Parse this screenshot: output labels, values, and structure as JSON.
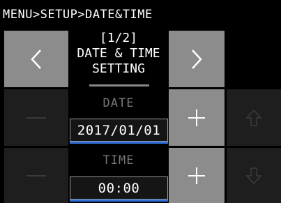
{
  "breadcrumb": "MENU>SETUP>DATE&TIME",
  "header": {
    "page_indicator": "[1/2]",
    "title_line1": "DATE & TIME",
    "title_line2": "SETTING"
  },
  "date": {
    "label": "DATE",
    "value": "2017/01/01"
  },
  "time": {
    "label": "TIME",
    "value": "00:00"
  },
  "icons": {
    "prev": "chevron-left-icon",
    "next": "chevron-right-icon",
    "decrement": "minus-icon",
    "increment": "plus-icon",
    "up": "arrow-up-icon",
    "down": "arrow-down-icon"
  },
  "colors": {
    "background": "#000000",
    "button": "#8c8c8c",
    "button_disabled": "#1e1e1e",
    "selection_bar": "#2f6fdc"
  }
}
